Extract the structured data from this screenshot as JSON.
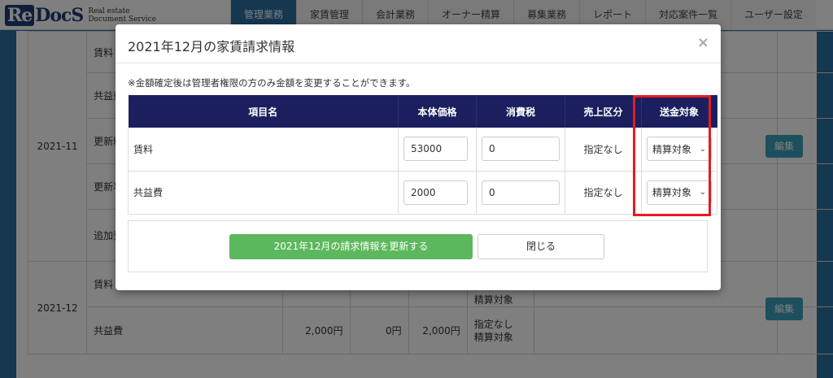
{
  "header": {
    "logo_text": "ReDocS",
    "logo_sub1": "Real estate",
    "logo_sub2": "Document Service",
    "nav": [
      "管理業務",
      "家賃管理",
      "会計業務",
      "オーナー精算",
      "募集業務",
      "レポート",
      "対応案件一覧",
      "ユーザー設定"
    ]
  },
  "background": {
    "rows_2021_11": {
      "month": "2021-11",
      "items": [
        "賃料",
        "共益費",
        "更新料",
        "更新事",
        "追加預"
      ]
    },
    "rows_2021_12": {
      "month": "2021-12",
      "items": [
        "賃料",
        "共益費"
      ],
      "kyoeki_values": [
        "2,000円",
        "0円",
        "2,000円"
      ],
      "stack_top": "精算対象",
      "stack_a": "指定なし",
      "stack_b": "精算対象"
    },
    "edit_label": "編集"
  },
  "modal": {
    "title": "2021年12月の家賃請求情報",
    "close": "×",
    "note": "※金額確定後は管理者権限の方のみ金額を変更することができます。",
    "columns": [
      "項目名",
      "本体価格",
      "消費税",
      "売上区分",
      "送金対象"
    ],
    "rows": [
      {
        "name": "賃料",
        "price": "53000",
        "tax": "0",
        "category": "指定なし",
        "target": "精算対象"
      },
      {
        "name": "共益費",
        "price": "2000",
        "tax": "0",
        "category": "指定なし",
        "target": "精算対象"
      }
    ],
    "update_button": "2021年12月の請求情報を更新する",
    "close_button": "閉じる"
  },
  "colors": {
    "nav_active": "#2a6ea0",
    "table_header": "#1b1f5e",
    "update_button": "#5cb85c",
    "highlight": "#e31b23",
    "edit_button": "#3aa0b8"
  }
}
